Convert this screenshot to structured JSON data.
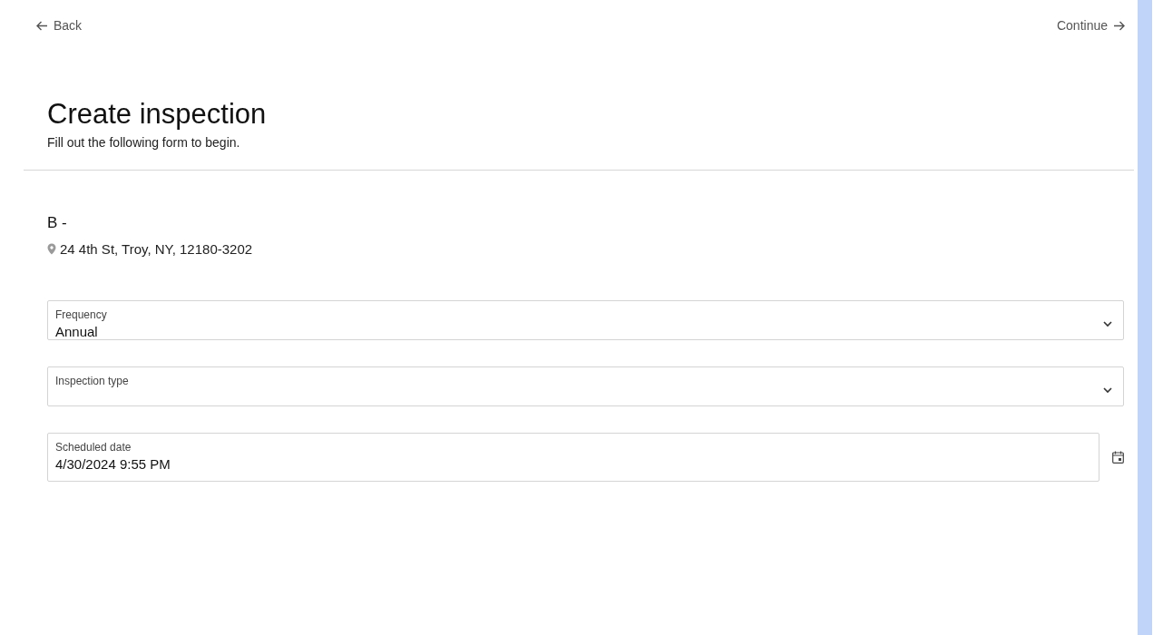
{
  "nav": {
    "back": "Back",
    "continue": "Continue"
  },
  "header": {
    "title": "Create inspection",
    "subtitle": "Fill out the following form to begin."
  },
  "location": {
    "name": "B -",
    "address": "24 4th St, Troy, NY, 12180-3202"
  },
  "fields": [
    {
      "kind": "select",
      "label": "Frequency",
      "value": "Annual"
    },
    {
      "kind": "select",
      "label": "Inspection type"
    },
    {
      "kind": "date",
      "label": "Scheduled date",
      "value": "4/30/2024 9:55 PM"
    }
  ]
}
